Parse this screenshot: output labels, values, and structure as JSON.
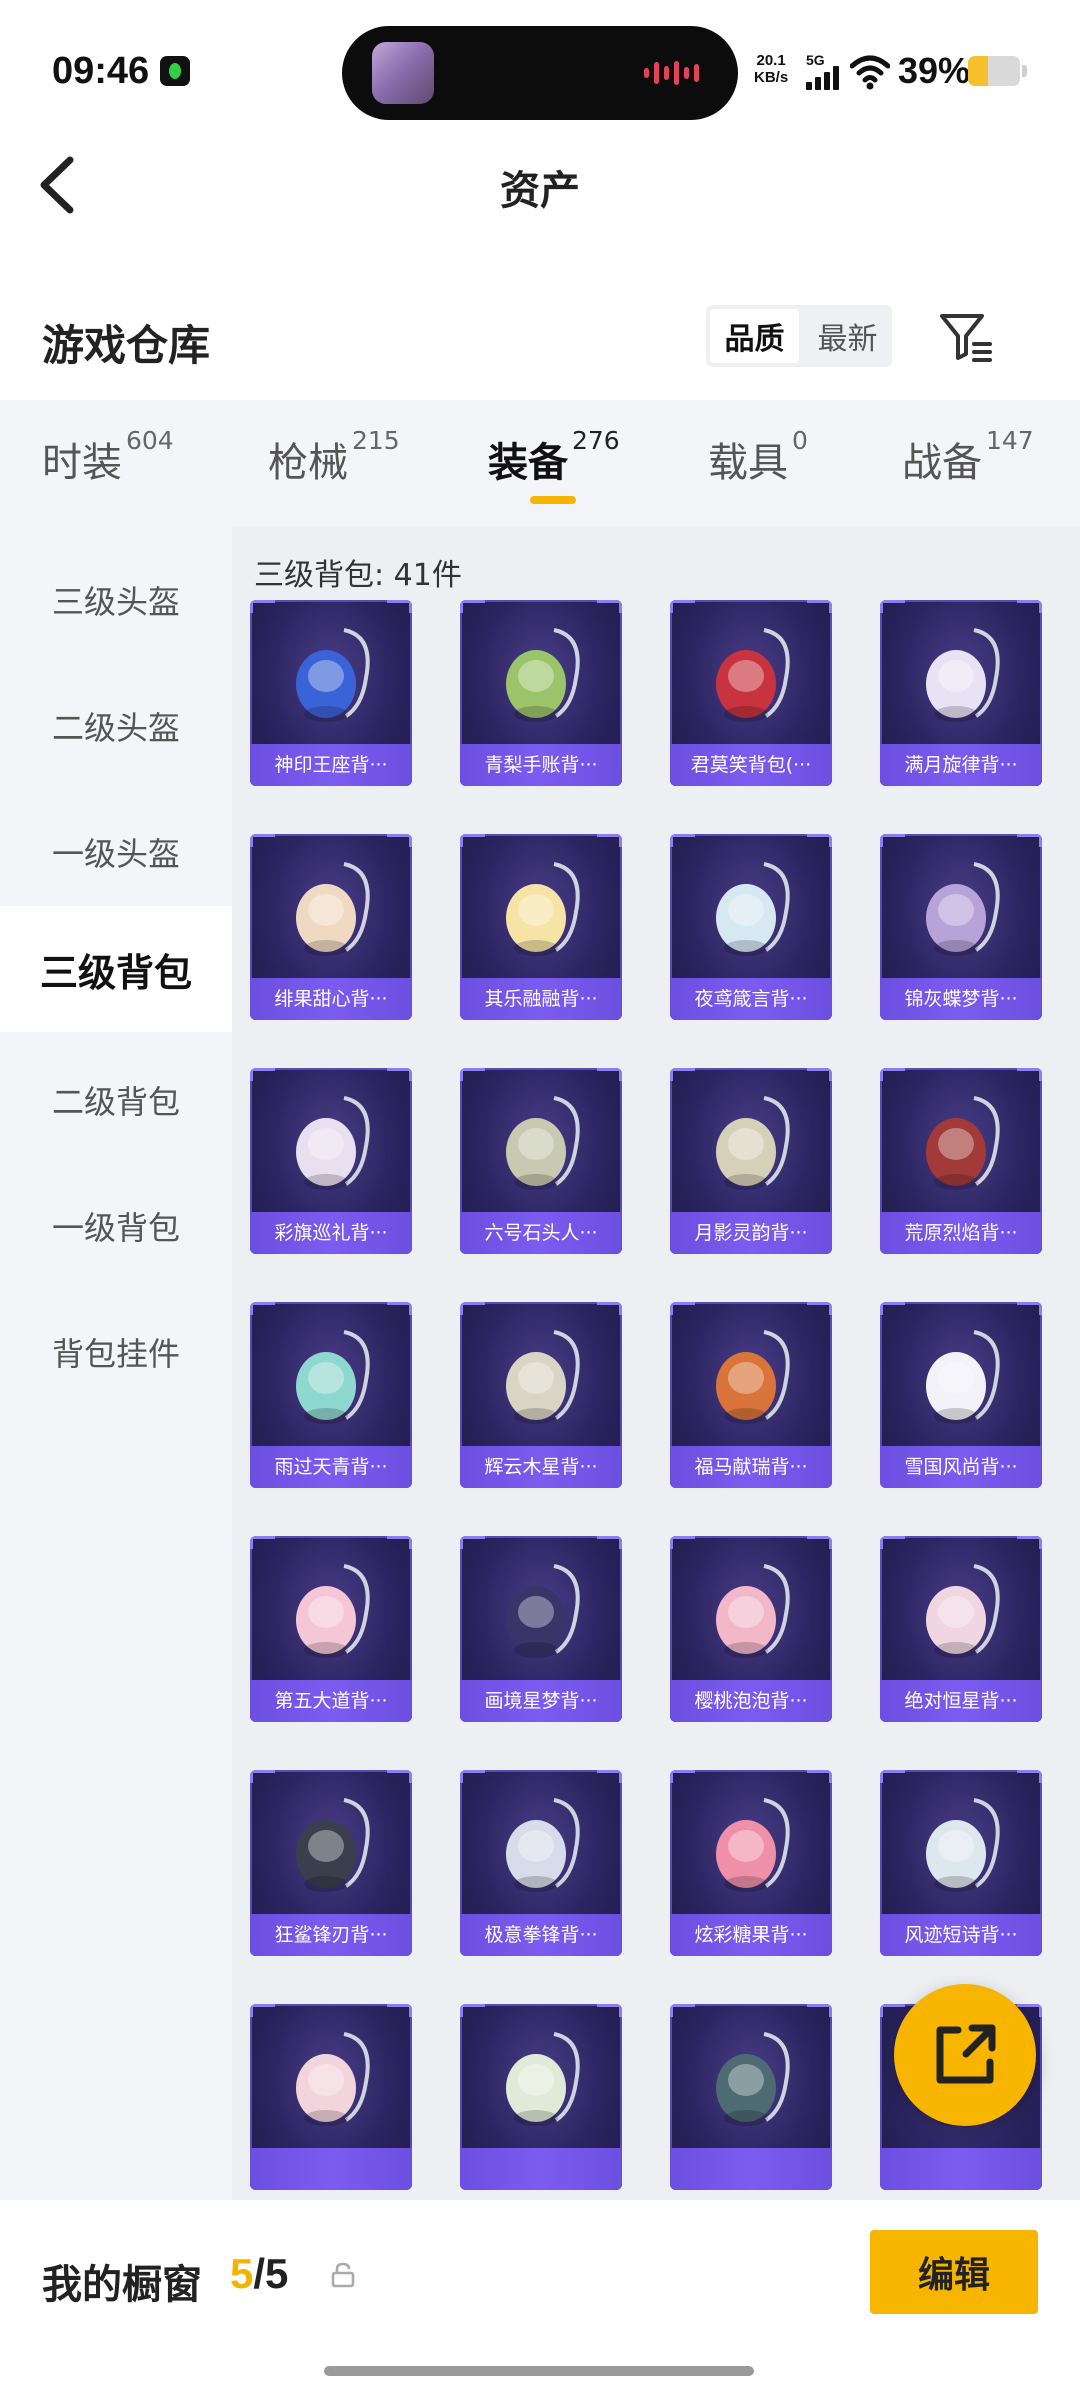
{
  "status_bar": {
    "time": "09:46",
    "net_speed_value": "20.1",
    "net_speed_unit": "KB/s",
    "network": "5G",
    "battery_percent": "39%",
    "battery_level": 0.39,
    "battery_color": "#f5c12c"
  },
  "header": {
    "back_icon": "chevron-left-icon",
    "title": "资产"
  },
  "warehouse": {
    "title": "游戏仓库",
    "sort_options": [
      "品质",
      "最新"
    ],
    "sort_selected": "品质",
    "filter_icon": "filter-icon"
  },
  "tabs": [
    {
      "label": "时装",
      "count": "604"
    },
    {
      "label": "枪械",
      "count": "215"
    },
    {
      "label": "装备",
      "count": "276",
      "active": true
    },
    {
      "label": "载具",
      "count": "0"
    },
    {
      "label": "战备",
      "count": "147"
    }
  ],
  "sidebar": {
    "items": [
      "三级头盔",
      "二级头盔",
      "一级头盔",
      "三级背包",
      "二级背包",
      "一级背包",
      "背包挂件"
    ],
    "active_index": 3
  },
  "content": {
    "section_label": "三级背包: 41件",
    "items": [
      "神印王座背···",
      "青梨手账背···",
      "君莫笑背包(···",
      "满月旋律背···",
      "绯果甜心背···",
      "其乐融融背···",
      "夜鸢箴言背···",
      "锦灰蝶梦背···",
      "彩旗巡礼背···",
      "六号石头人···",
      "月影灵韵背···",
      "荒原烈焰背···",
      "雨过天青背···",
      "辉云木星背···",
      "福马献瑞背···",
      "雪国风尚背···",
      "第五大道背···",
      "画境星梦背···",
      "樱桃泡泡背···",
      "绝对恒星背···",
      "狂鲨锋刃背···",
      "极意拳锋背···",
      "炫彩糖果背···",
      "风迹短诗背···",
      "",
      "",
      "",
      ""
    ],
    "item_colors": [
      "#3b63d8",
      "#9bc46a",
      "#c9333f",
      "#e8e2f5",
      "#f0d9c2",
      "#f5e4a6",
      "#d6e8f2",
      "#b8a3d9",
      "#e8dff0",
      "#c7c9b0",
      "#d7d0b8",
      "#a33a3a",
      "#8fd8cf",
      "#d9d5c4",
      "#d9743a",
      "#f2f2f8",
      "#f5c6d6",
      "#3a3468",
      "#f2b7c9",
      "#f0d6e0",
      "#3a3f4d",
      "#d8dcea",
      "#f08fa8",
      "#dde7ee",
      "#f2d4dc",
      "#e1ead8",
      "#4e6a72",
      "#f1e6d9"
    ]
  },
  "fab": {
    "icon": "share-icon",
    "color": "#f7b500"
  },
  "bottom_bar": {
    "window_label": "我的橱窗",
    "used": "5",
    "total": "5",
    "lock_icon": "lock-icon",
    "edit_label": "编辑"
  }
}
